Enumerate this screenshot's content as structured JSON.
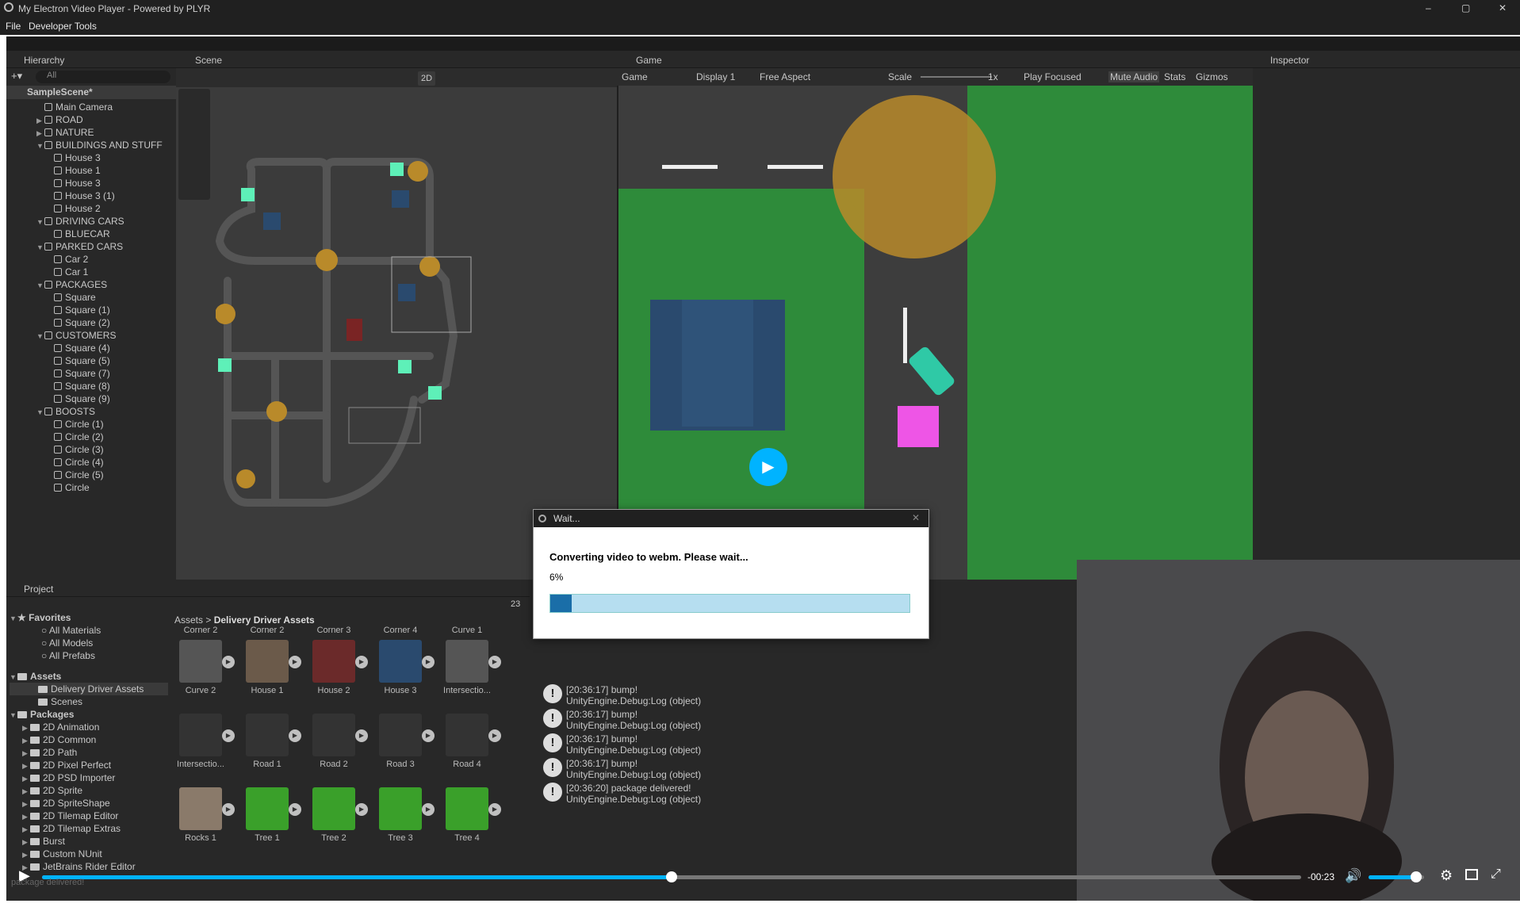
{
  "window": {
    "title": "My Electron Video Player - Powered by PLYR",
    "minimize": "–",
    "maximize": "▢",
    "close": "✕"
  },
  "menu": [
    "File",
    "Developer Tools"
  ],
  "hierarchy": {
    "title": "Hierarchy",
    "search": "All",
    "scene": "SampleScene*",
    "items": [
      {
        "label": "Main Camera",
        "depth": 1,
        "arrow": ""
      },
      {
        "label": "ROAD",
        "depth": 1,
        "arrow": "▶"
      },
      {
        "label": "NATURE",
        "depth": 1,
        "arrow": "▶"
      },
      {
        "label": "BUILDINGS AND STUFF",
        "depth": 1,
        "arrow": "▼"
      },
      {
        "label": "House 3",
        "depth": 2,
        "arrow": ""
      },
      {
        "label": "House 1",
        "depth": 2,
        "arrow": ""
      },
      {
        "label": "House 3",
        "depth": 2,
        "arrow": ""
      },
      {
        "label": "House 3 (1)",
        "depth": 2,
        "arrow": ""
      },
      {
        "label": "House 2",
        "depth": 2,
        "arrow": ""
      },
      {
        "label": "DRIVING CARS",
        "depth": 1,
        "arrow": "▼"
      },
      {
        "label": "BLUECAR",
        "depth": 2,
        "arrow": ""
      },
      {
        "label": "PARKED CARS",
        "depth": 1,
        "arrow": "▼"
      },
      {
        "label": "Car 2",
        "depth": 2,
        "arrow": ""
      },
      {
        "label": "Car 1",
        "depth": 2,
        "arrow": ""
      },
      {
        "label": "PACKAGES",
        "depth": 1,
        "arrow": "▼"
      },
      {
        "label": "Square",
        "depth": 2,
        "arrow": ""
      },
      {
        "label": "Square (1)",
        "depth": 2,
        "arrow": ""
      },
      {
        "label": "Square (2)",
        "depth": 2,
        "arrow": ""
      },
      {
        "label": "CUSTOMERS",
        "depth": 1,
        "arrow": "▼"
      },
      {
        "label": "Square (4)",
        "depth": 2,
        "arrow": ""
      },
      {
        "label": "Square (5)",
        "depth": 2,
        "arrow": ""
      },
      {
        "label": "Square (7)",
        "depth": 2,
        "arrow": ""
      },
      {
        "label": "Square (8)",
        "depth": 2,
        "arrow": ""
      },
      {
        "label": "Square (9)",
        "depth": 2,
        "arrow": ""
      },
      {
        "label": "BOOSTS",
        "depth": 1,
        "arrow": "▼"
      },
      {
        "label": "Circle (1)",
        "depth": 2,
        "arrow": ""
      },
      {
        "label": "Circle (2)",
        "depth": 2,
        "arrow": ""
      },
      {
        "label": "Circle (3)",
        "depth": 2,
        "arrow": ""
      },
      {
        "label": "Circle (4)",
        "depth": 2,
        "arrow": ""
      },
      {
        "label": "Circle (5)",
        "depth": 2,
        "arrow": ""
      },
      {
        "label": "Circle",
        "depth": 2,
        "arrow": ""
      }
    ]
  },
  "scene": {
    "title": "Scene",
    "mode_2d": "2D"
  },
  "game": {
    "title": "Game",
    "dropdown": "Game",
    "display": "Display 1",
    "aspect": "Free Aspect",
    "scale_label": "Scale",
    "scale_value": "1x",
    "play_focused": "Play Focused",
    "mute": "Mute Audio",
    "stats": "Stats",
    "gizmos": "Gizmos"
  },
  "inspector": {
    "title": "Inspector"
  },
  "project": {
    "title": "Project",
    "favorites": "Favorites",
    "fav_items": [
      "All Materials",
      "All Models",
      "All Prefabs"
    ],
    "assets": "Assets",
    "asset_items": [
      "Delivery Driver Assets",
      "Scenes"
    ],
    "packages": "Packages",
    "package_items": [
      "2D Animation",
      "2D Common",
      "2D Path",
      "2D Pixel Perfect",
      "2D PSD Importer",
      "2D Sprite",
      "2D SpriteShape",
      "2D Tilemap Editor",
      "2D Tilemap Extras",
      "Burst",
      "Custom NUnit",
      "JetBrains Rider Editor"
    ],
    "breadcrumb_root": "Assets",
    "breadcrumb_leaf": "Delivery Driver Assets",
    "count": "23",
    "top_row": [
      "Corner 2",
      "Corner 2",
      "Corner 3",
      "Corner 4",
      "Curve 1"
    ],
    "row1": [
      "Curve 2",
      "House 1",
      "House 2",
      "House 3",
      "Intersectio..."
    ],
    "row2": [
      "Intersectio...",
      "Road 1",
      "Road 2",
      "Road 3",
      "Road 4"
    ],
    "row3": [
      "Rocks 1",
      "Tree 1",
      "Tree 2",
      "Tree 3",
      "Tree 4"
    ]
  },
  "console": [
    {
      "time": "[20:36:17] bump!",
      "src": "UnityEngine.Debug:Log (object)"
    },
    {
      "time": "[20:36:17] bump!",
      "src": "UnityEngine.Debug:Log (object)"
    },
    {
      "time": "[20:36:17] bump!",
      "src": "UnityEngine.Debug:Log (object)"
    },
    {
      "time": "[20:36:17] bump!",
      "src": "UnityEngine.Debug:Log (object)"
    },
    {
      "time": "[20:36:20] package delivered!",
      "src": "UnityEngine.Debug:Log (object)"
    }
  ],
  "status_line": "package delivered!",
  "dialog": {
    "title": "Wait...",
    "message": "Converting video to webm. Please wait...",
    "percent": "6%",
    "progress": 0.06
  },
  "controls": {
    "time": "-00:23",
    "seek": 0.5,
    "volume": 0.85
  },
  "colors": {
    "accent": "#00b3ff",
    "grass": "#2e8b3a",
    "road": "#3d3d3d",
    "house": "#2a4a6e",
    "pink": "#ee55e6"
  }
}
